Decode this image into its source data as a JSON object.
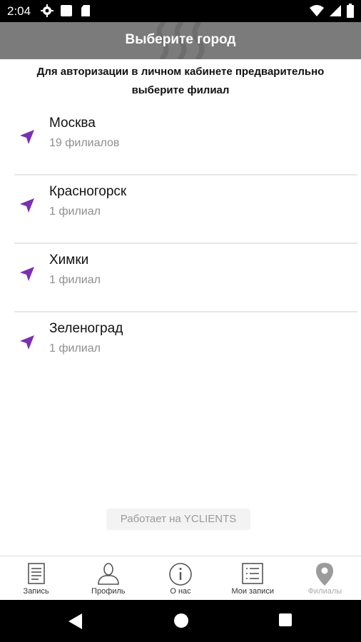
{
  "status_bar": {
    "time": "2:04",
    "icons": [
      "gear-icon",
      "square-icon",
      "sd-card-icon",
      "wifi-icon",
      "signal-icon",
      "battery-icon"
    ]
  },
  "header": {
    "title": "Выберите город"
  },
  "notice": {
    "text": "Для авторизации в личном кабинете предварительно выберите филиал"
  },
  "cities": [
    {
      "name": "Москва",
      "count": "19 филиалов"
    },
    {
      "name": "Красногорск",
      "count": "1 филиал"
    },
    {
      "name": "Химки",
      "count": "1 филиал"
    },
    {
      "name": "Зеленоград",
      "count": "1 филиал"
    }
  ],
  "powered_by": "Работает на YCLIENTS",
  "tabs": [
    {
      "label": "Запись",
      "icon": "document-icon",
      "active": false
    },
    {
      "label": "Профиль",
      "icon": "person-icon",
      "active": false
    },
    {
      "label": "О нас",
      "icon": "info-icon",
      "active": false
    },
    {
      "label": "Мои записи",
      "icon": "list-icon",
      "active": false
    },
    {
      "label": "Филиалы",
      "icon": "map-pin-icon",
      "active": true
    }
  ],
  "colors": {
    "header_bg": "#7b7b7b",
    "accent": "#7b2fb5"
  }
}
